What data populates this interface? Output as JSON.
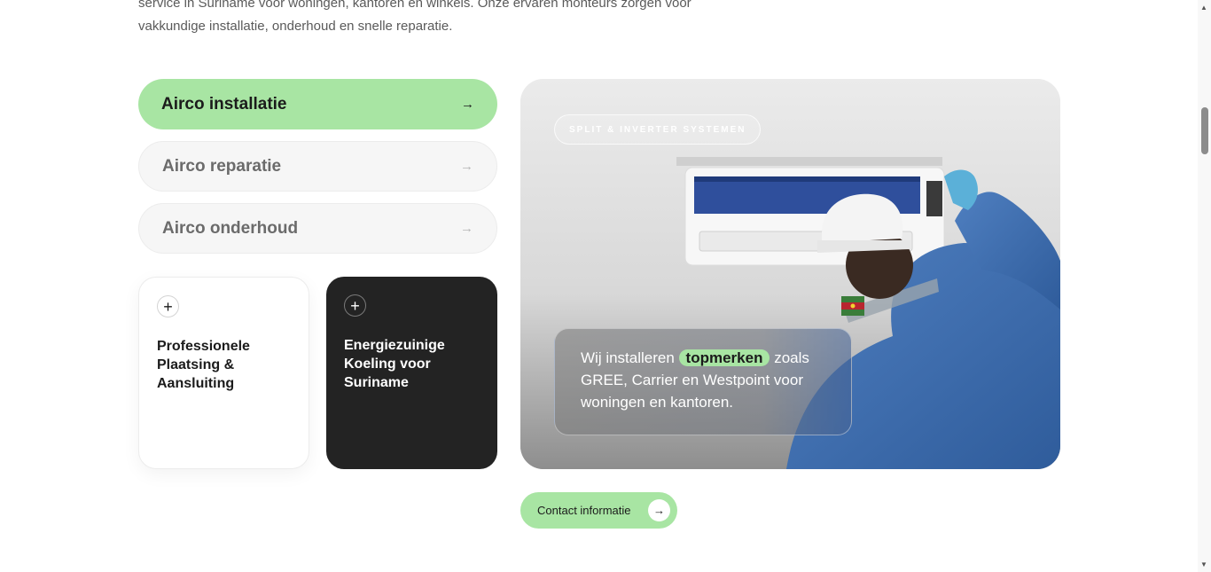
{
  "intro": {
    "line1": "service in Suriname voor woningen, kantoren en winkels. Onze ervaren monteurs zorgen voor",
    "line2": "vakkundige installatie, onderhoud en snelle reparatie."
  },
  "tabs": [
    {
      "label": "Airco installatie",
      "arrow": "→",
      "active": true
    },
    {
      "label": "Airco reparatie",
      "arrow": "→",
      "active": false
    },
    {
      "label": "Airco onderhoud",
      "arrow": "→",
      "active": false
    }
  ],
  "cards": [
    {
      "icon": "plus-icon",
      "symbol": "+",
      "title": "Professionele Plaatsing & Aansluiting"
    },
    {
      "icon": "plus-icon",
      "symbol": "+",
      "title": "Energiezuinige Koeling voor Suriname"
    }
  ],
  "hero": {
    "chip": "SPLIT & INVERTER SYSTEMEN",
    "quote_before": "Wij installeren ",
    "quote_highlight": "topmerken",
    "quote_after": " zoals GREE, Carrier en Westpoint voor woningen en kantoren."
  },
  "cta": {
    "label": "Contact informatie",
    "icon": "arrow-right-icon",
    "symbol": "→"
  },
  "scrollbar": {
    "up": "▲",
    "down": "▼"
  },
  "colors": {
    "accent": "#a8e5a3",
    "dark_card": "#232323",
    "text": "#1f1f1f",
    "muted": "#6b6b6b"
  }
}
